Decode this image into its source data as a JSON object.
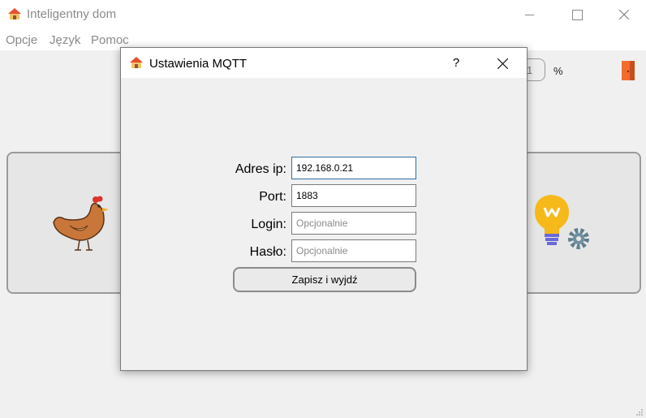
{
  "app": {
    "title": "Inteligentny dom",
    "icon": "house-icon"
  },
  "menu": {
    "items": [
      {
        "label": "Opcje"
      },
      {
        "label": "Język"
      },
      {
        "label": "Pomoc"
      }
    ]
  },
  "background": {
    "field_value": "1",
    "percent_label": "%",
    "icons": [
      "door-icon",
      "chicken-icon",
      "lightbulb-gear-icon"
    ]
  },
  "dialog": {
    "title": "Ustawienia MQTT",
    "help_label": "?",
    "fields": {
      "ip": {
        "label": "Adres ip:",
        "value": "192.168.0.21",
        "placeholder": ""
      },
      "port": {
        "label": "Port:",
        "value": "1883",
        "placeholder": ""
      },
      "login": {
        "label": "Login:",
        "value": "",
        "placeholder": "Opcjonalnie"
      },
      "password": {
        "label": "Hasło:",
        "value": "",
        "placeholder": "Opcjonalnie"
      }
    },
    "save_label": "Zapisz i wyjdź"
  },
  "colors": {
    "window_bg": "#f0f0f0",
    "titlebar_bg": "#ffffff",
    "focus_border": "#2f6fa3",
    "door_orange": "#f26c2f"
  }
}
